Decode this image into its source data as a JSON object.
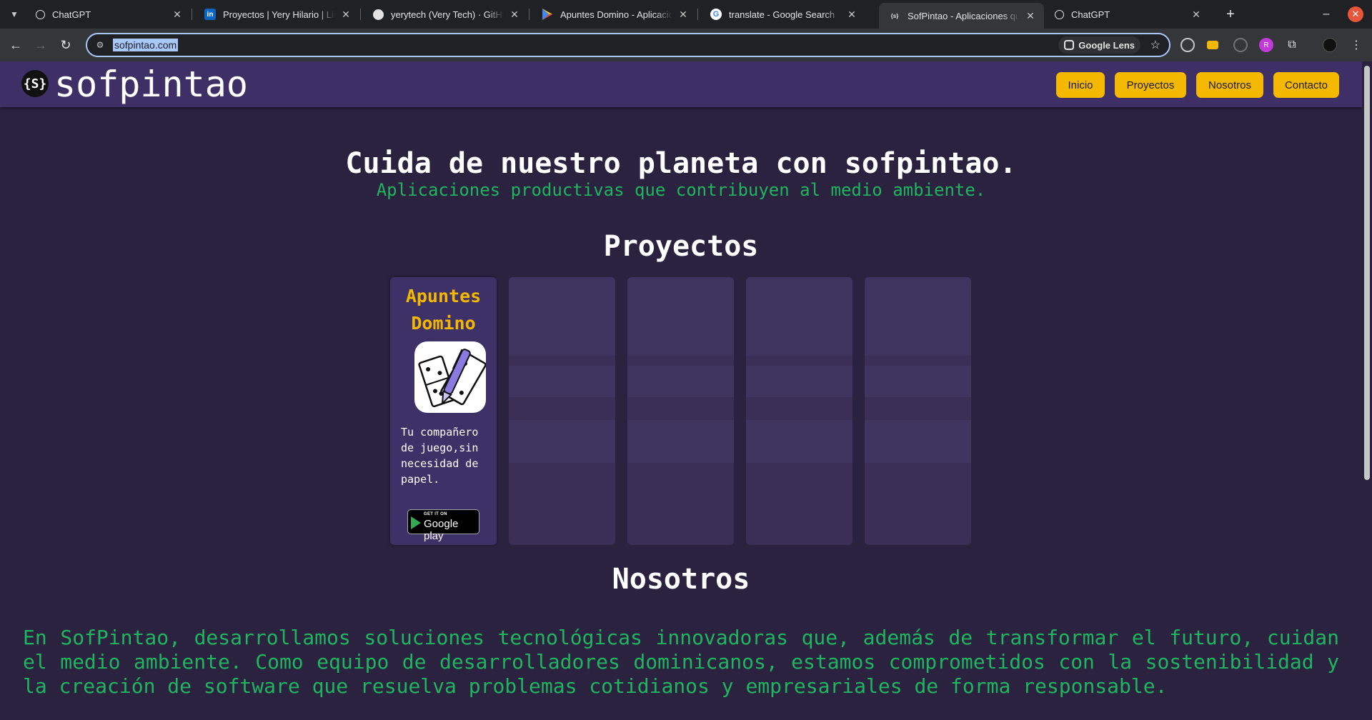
{
  "browser": {
    "tabs": [
      {
        "title": "ChatGPT",
        "icon": "chatgpt-icon",
        "active": false
      },
      {
        "title": "Proyectos | Yery Hilario | LinkedIn",
        "icon": "linkedin-icon",
        "active": false
      },
      {
        "title": "yerytech (Very Tech) · GitHub",
        "icon": "github-icon",
        "active": false
      },
      {
        "title": "Apuntes Domino - Aplicaciones en Google Play",
        "icon": "google-play-icon",
        "active": false
      },
      {
        "title": "translate - Google Search",
        "icon": "google-icon",
        "active": false
      },
      {
        "title": "SofPintao - Aplicaciones que",
        "icon": "sofpintao-favicon-icon",
        "active": true
      },
      {
        "title": "ChatGPT",
        "icon": "chatgpt-icon",
        "active": false
      }
    ],
    "url": "sofpintao.com",
    "lens_label": "Google Lens"
  },
  "site": {
    "logo_badge": "{S}",
    "logo_text": "sofpintao",
    "nav": [
      "Inicio",
      "Proyectos",
      "Nosotros",
      "Contacto"
    ]
  },
  "hero": {
    "title": "Cuida de nuestro planeta con sofpintao.",
    "subtitle": "Aplicaciones productivas que contribuyen al medio ambiente."
  },
  "projects": {
    "heading": "Proyectos",
    "cards": [
      {
        "title": "Apuntes Domino",
        "description": "Tu compañero de juego,sin necesidad de papel.",
        "badge_small": "GET IT ON",
        "badge_store": "Google play"
      }
    ]
  },
  "about": {
    "heading": "Nosotros",
    "text": "En SofPintao, desarrollamos soluciones tecnológicas innovadoras que, además de transformar el futuro, cuidan el medio ambiente. Como equipo de desarrolladores dominicanos, estamos comprometidos con la sostenibilidad y la creación de software que resuelva problemas cotidianos y empresariales de forma responsable."
  },
  "colors": {
    "page_bg": "#2b2240",
    "header_bg": "#3e3066",
    "accent_yellow": "#f5b800",
    "accent_green": "#1fb55e"
  }
}
